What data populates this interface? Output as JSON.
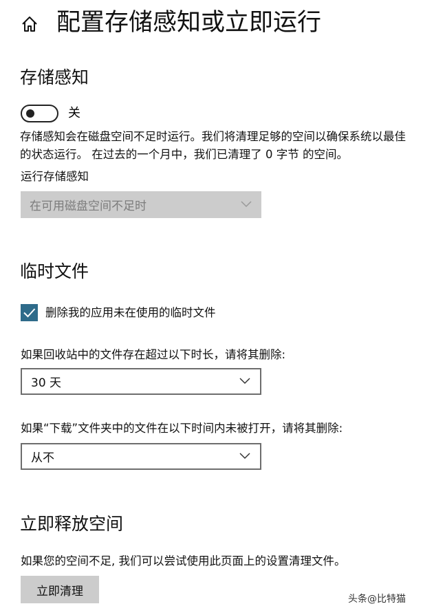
{
  "header": {
    "icon": "home-icon",
    "title": "配置存储感知或立即运行"
  },
  "storage_sense": {
    "title": "存储感知",
    "toggle_state": "off",
    "toggle_label": "关",
    "description": "存储感知会在磁盘空间不足时运行。我们将清理足够的空间以确保系统以最佳的状态运行。 在过去的一个月中，我们已清理了 0 字节 的空间。",
    "run_label": "运行存储感知",
    "run_value": "在可用磁盘空间不足时"
  },
  "temp_files": {
    "title": "临时文件",
    "checkbox_checked": true,
    "checkbox_label": "删除我的应用未在使用的临时文件",
    "recycle_label": "如果回收站中的文件存在超过以下时长，请将其删除:",
    "recycle_value": "30 天",
    "downloads_label": "如果“下载”文件夹中的文件在以下时间内未被打开，请将其删除:",
    "downloads_value": "从不"
  },
  "free_space": {
    "title": "立即释放空间",
    "description": "如果您的空间不足, 我们可以尝试使用此页面上的设置清理文件。",
    "button_label": "立即清理"
  },
  "watermark": "头条@比特猫",
  "colors": {
    "checkbox": "#2e6b8a",
    "disabled_dropdown": "#cccccc",
    "button": "#cccccc"
  }
}
